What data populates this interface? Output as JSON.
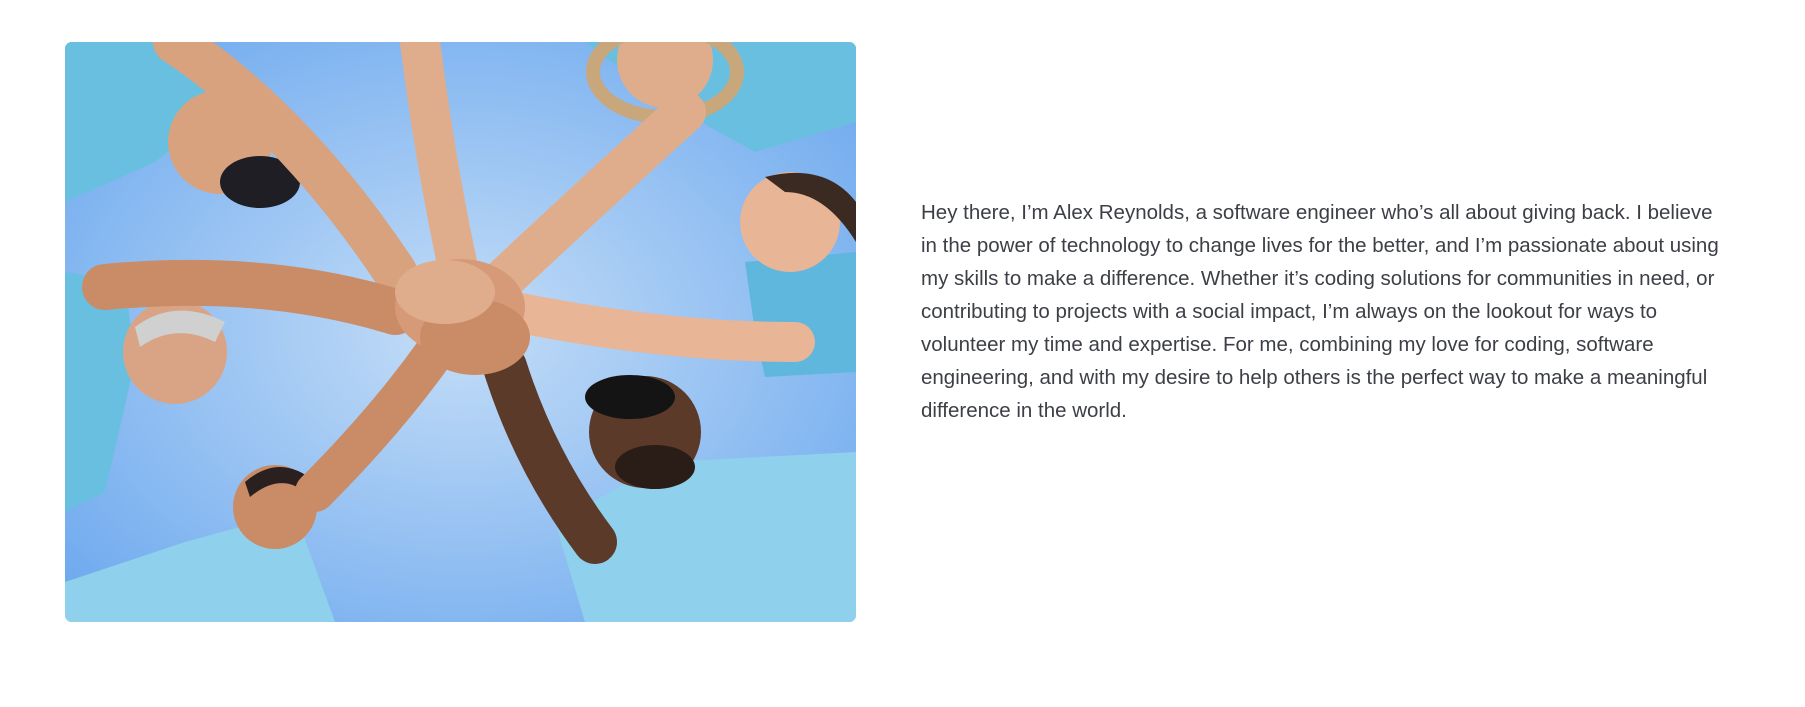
{
  "image": {
    "icon": "team-hands-stack-photo",
    "colors": {
      "sky_light": "#b7d6f7",
      "sky_dark": "#6aa7ee",
      "shirt": "#69bfe0",
      "shirt_light": "#9dd6ee",
      "skin": "#d69a78",
      "skin_dark": "#5b3a2a"
    }
  },
  "bio": {
    "text": "Hey there, I’m Alex Reynolds, a software engineer who’s all about giving back. I believe in the power of technology to change lives for the better, and I’m passionate about using my skills to make a difference. Whether it’s coding solutions for communities in need, or contributing to projects with a social impact, I’m always on the lookout for ways to volunteer my time and expertise. For me, combining my love for coding, software engineering, and with my desire to help others is the perfect way to make a meaningful difference in the world."
  }
}
